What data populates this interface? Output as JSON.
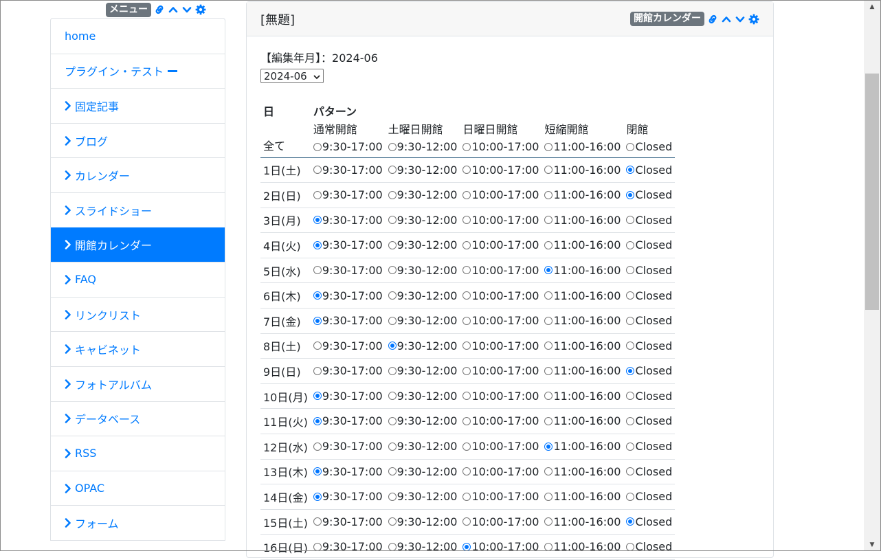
{
  "menu": {
    "badge": "メニュー",
    "items": [
      {
        "label": "home",
        "chevron": false,
        "active": false,
        "dash": false
      },
      {
        "label": "プラグイン・テスト",
        "chevron": false,
        "active": false,
        "dash": true
      },
      {
        "label": "固定記事",
        "chevron": true,
        "active": false,
        "dash": false
      },
      {
        "label": "ブログ",
        "chevron": true,
        "active": false,
        "dash": false
      },
      {
        "label": "カレンダー",
        "chevron": true,
        "active": false,
        "dash": false
      },
      {
        "label": "スライドショー",
        "chevron": true,
        "active": false,
        "dash": false
      },
      {
        "label": "開館カレンダー",
        "chevron": true,
        "active": true,
        "dash": false
      },
      {
        "label": "FAQ",
        "chevron": true,
        "active": false,
        "dash": false
      },
      {
        "label": "リンクリスト",
        "chevron": true,
        "active": false,
        "dash": false
      },
      {
        "label": "キャビネット",
        "chevron": true,
        "active": false,
        "dash": false
      },
      {
        "label": "フォトアルバム",
        "chevron": true,
        "active": false,
        "dash": false
      },
      {
        "label": "データベース",
        "chevron": true,
        "active": false,
        "dash": false
      },
      {
        "label": "RSS",
        "chevron": true,
        "active": false,
        "dash": false
      },
      {
        "label": "OPAC",
        "chevron": true,
        "active": false,
        "dash": false
      },
      {
        "label": "フォーム",
        "chevron": true,
        "active": false,
        "dash": false
      }
    ]
  },
  "frame": {
    "title": "[無題]",
    "badge": "開館カレンダー"
  },
  "editor": {
    "edit_month_label": "【編集年月】",
    "edit_month_sep": "：",
    "edit_month_value": "2024-06",
    "select_value": "2024-06",
    "day_header": "日",
    "pattern_header": "パターン",
    "all_label": "全て",
    "patterns": [
      {
        "name": "通常開館",
        "time": "9:30-17:00"
      },
      {
        "name": "土曜日開館",
        "time": "9:30-12:00"
      },
      {
        "name": "日曜日開館",
        "time": "10:00-17:00"
      },
      {
        "name": "短縮開館",
        "time": "11:00-16:00"
      },
      {
        "name": "閉館",
        "time": "Closed"
      }
    ],
    "days": [
      {
        "label": "1日(土)",
        "selected": 4
      },
      {
        "label": "2日(日)",
        "selected": 4
      },
      {
        "label": "3日(月)",
        "selected": 0
      },
      {
        "label": "4日(火)",
        "selected": 0
      },
      {
        "label": "5日(水)",
        "selected": 3
      },
      {
        "label": "6日(木)",
        "selected": 0
      },
      {
        "label": "7日(金)",
        "selected": 0
      },
      {
        "label": "8日(土)",
        "selected": 1
      },
      {
        "label": "9日(日)",
        "selected": 4
      },
      {
        "label": "10日(月)",
        "selected": 0
      },
      {
        "label": "11日(火)",
        "selected": 0
      },
      {
        "label": "12日(水)",
        "selected": 3
      },
      {
        "label": "13日(木)",
        "selected": 0
      },
      {
        "label": "14日(金)",
        "selected": 0
      },
      {
        "label": "15日(土)",
        "selected": 4
      },
      {
        "label": "16日(日)",
        "selected": 2
      }
    ]
  },
  "colors": {
    "accent": "#007bff",
    "badge_bg": "#6c757d",
    "radio_on": "#0075ff"
  }
}
